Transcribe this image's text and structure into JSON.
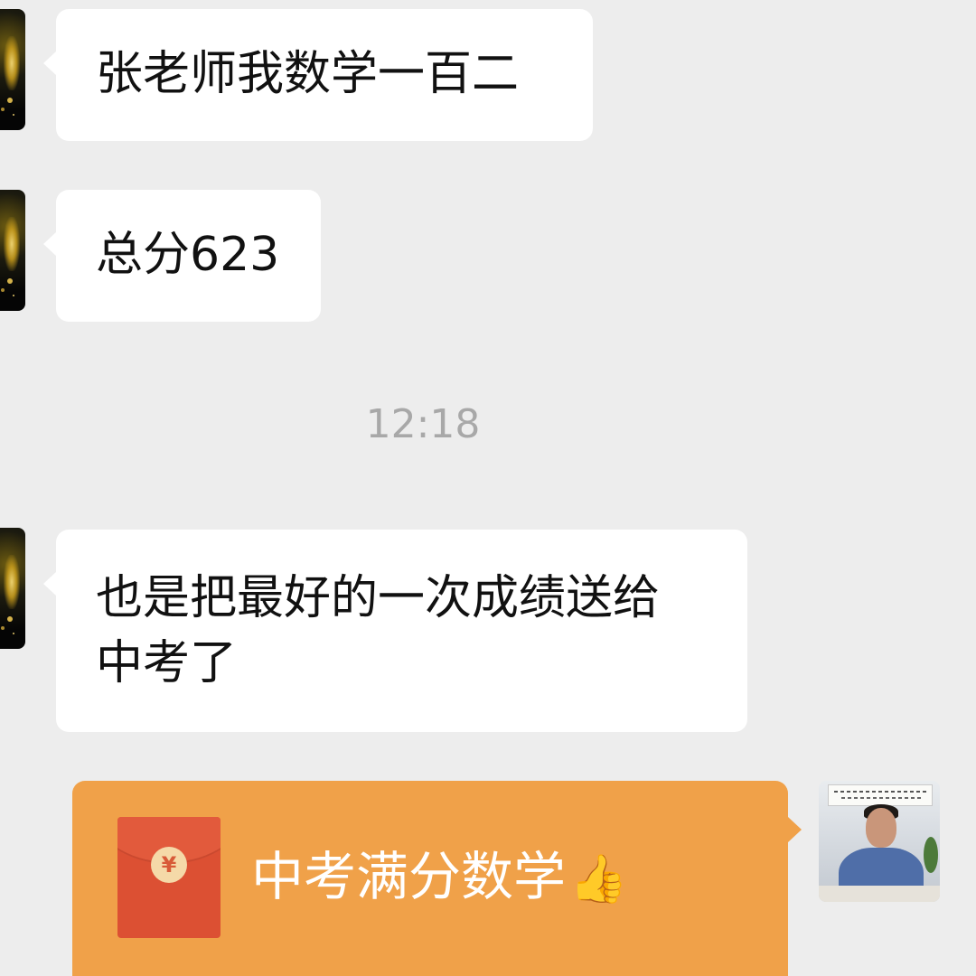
{
  "messages": [
    {
      "sender": "student",
      "text": "张老师我数学一百二"
    },
    {
      "sender": "student",
      "text": "总分623"
    },
    {
      "sender": "student",
      "text": "也是把最好的一次成绩送给\n中考了"
    }
  ],
  "timestamp": "12:18",
  "red_packet": {
    "title": "中考满分数学",
    "emoji": "👍",
    "coin_symbol": "¥",
    "color": "#f0a149",
    "envelope_color": "#dc5033"
  },
  "colors": {
    "background": "#ededed",
    "bubble": "#ffffff",
    "timestamp_text": "#a8a8a8"
  }
}
